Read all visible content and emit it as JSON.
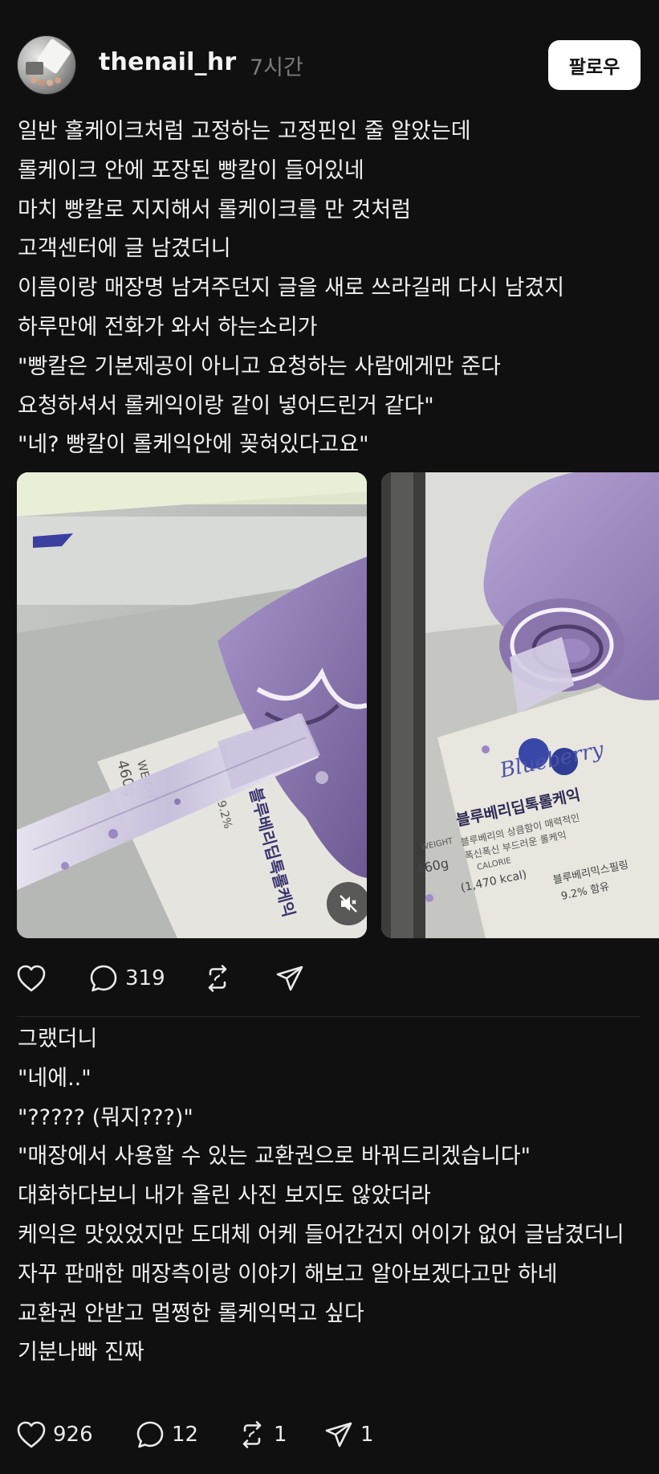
{
  "post": {
    "username": "thenail_hr",
    "timestamp": "7시간",
    "follow_label": "팔로우",
    "text": "일반 홀케이크처럼 고정하는 고정핀인 줄 알았는데\n롤케이크 안에 포장된 빵칼이 들어있네\n마치 빵칼로 지지해서 롤케이크를 만 것처럼\n고객센터에 글 남겼더니\n이름이랑 매장명 남겨주던지 글을 새로 쓰라길래 다시 남겼지\n하루만에 전화가 와서 하는소리가\n\"빵칼은 기본제공이 아니고 요청하는 사람에게만 준다\n요청하셔서 롤케익이랑 같이 넣어드린거 같다\"\n\"네? 빵칼이 롤케익안에 꽂혀있다고요\"",
    "media": {
      "image_1": {
        "package_text": "블루베리딥톡롤케익",
        "weight": "460g",
        "weight_label": "WEIGHT",
        "percent": "9.2%"
      },
      "image_2": {
        "brand_script": "Blueberry",
        "product_name": "블루베리딥톡롤케익",
        "tagline": "블루베리의 상큼함이 매력적인",
        "tagline2": "폭신폭신 부드러운 롤케익",
        "weight_label": "WEIGHT",
        "weight": "460g",
        "calorie_label": "CALORIE",
        "calorie": "(1,470 kcal)",
        "mix": "블루베리믹스필링",
        "mix_percent": "9.2% 함유"
      }
    },
    "actions": {
      "likes": "",
      "replies": "319",
      "reposts": "",
      "shares": ""
    }
  },
  "reply": {
    "text": "그랬더니\n\"네에..\"\n\"????? (뭐지???)\"\n\"매장에서 사용할 수 있는 교환권으로 바꿔드리겠습니다\"\n대화하다보니 내가 올린 사진 보지도 않았더라\n케익은 맛있었지만 도대체 어케 들어간건지 어이가 없어 글남겼더니 자꾸 판매한 매장측이랑 이야기 해보고 알아보겠다고만 하네\n교환권 안받고 멀쩡한 롤케익먹고 싶다\n기분나빠 진짜",
    "actions": {
      "likes": "926",
      "replies": "12",
      "reposts": "1",
      "shares": "1"
    }
  },
  "colors": {
    "background": "#101010",
    "text": "#f0f0f0",
    "muted": "#7a7a7a",
    "cake_purple": "#8e78b2"
  },
  "icons": [
    "heart-icon",
    "comment-icon",
    "repost-icon",
    "share-icon",
    "mute-icon"
  ]
}
